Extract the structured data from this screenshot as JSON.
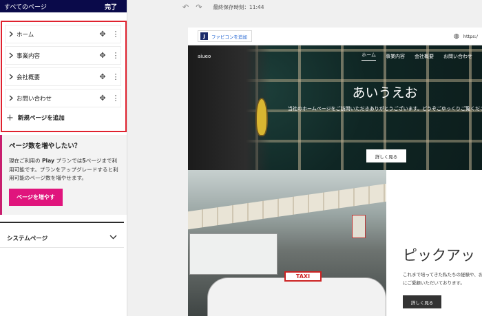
{
  "sidebar": {
    "title": "すべてのページ",
    "done_label": "完了",
    "pages": [
      {
        "label": "ホーム"
      },
      {
        "label": "事業内容"
      },
      {
        "label": "会社概要"
      },
      {
        "label": "お問い合わせ"
      }
    ],
    "add_page_label": "新規ページを追加",
    "upsell": {
      "heading": "ページ数を増やしたい？",
      "text_1": "現在ご利用の ",
      "plan": "Play",
      "text_2": " プランでは",
      "limit": "5",
      "text_3": "ページまで利用可能です。プランをアップグレードすると利用可能のページ数を増やせます。",
      "button_label": "ページを増やす"
    },
    "system_pages_label": "システムページ"
  },
  "toolbar": {
    "last_saved": "最終保存時刻：11:44"
  },
  "canvas": {
    "favicon_button": "ファビコンを追加",
    "favicon_letter": "J",
    "url": "https:/",
    "nav": {
      "brand": "aiueo",
      "items": [
        "ホーム",
        "事業内容",
        "会社概要",
        "お問い合わせ"
      ]
    },
    "hero": {
      "title": "あいうえお",
      "lead": "当社のホームページをご訪問いただきありがとうございます。どうぞごゆっくりご覧ください。",
      "button": "詳しく見る"
    },
    "pickup": {
      "title": "ピックアッ",
      "text": "これまで培ってきた私たちの経験や、お客様にご愛顧いただいております。",
      "button": "詳しく見る",
      "taxi_sign": "TAXI"
    }
  },
  "colors": {
    "header_bg": "#0a0a4a",
    "highlight_border": "#e0212e",
    "accent": "#e0157d"
  }
}
